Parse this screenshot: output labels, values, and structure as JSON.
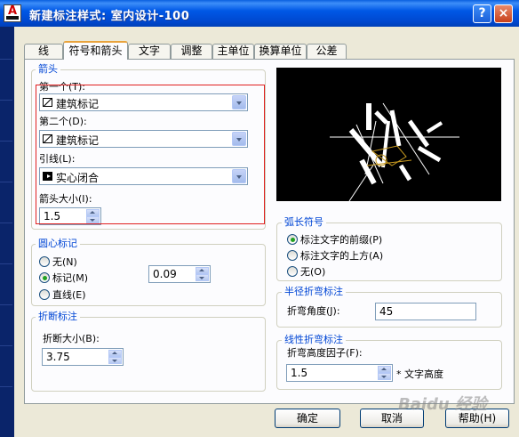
{
  "window": {
    "title": "新建标注样式: 室内设计-100",
    "help_symbol": "?",
    "close_symbol": "×",
    "app_icon_letter": "A"
  },
  "tabs": [
    "线",
    "符号和箭头",
    "文字",
    "调整",
    "主单位",
    "换算单位",
    "公差"
  ],
  "active_tab": "符号和箭头",
  "arrows": {
    "group_title": "箭头",
    "first_label": "第一个(T):",
    "first_value": "建筑标记",
    "second_label": "第二个(D):",
    "second_value": "建筑标记",
    "leader_label": "引线(L):",
    "leader_value": "实心闭合",
    "size_label": "箭头大小(I):",
    "size_value": "1.5"
  },
  "center_marks": {
    "group_title": "圆心标记",
    "options": [
      "无(N)",
      "标记(M)",
      "直线(E)"
    ],
    "selected": "标记(M)",
    "size_value": "0.09"
  },
  "break": {
    "group_title": "折断标注",
    "size_label": "折断大小(B):",
    "size_value": "3.75"
  },
  "arc_symbol": {
    "group_title": "弧长符号",
    "options": [
      "标注文字的前缀(P)",
      "标注文字的上方(A)",
      "无(O)"
    ],
    "selected": "标注文字的前缀(P)"
  },
  "radius_jog": {
    "group_title": "半径折弯标注",
    "angle_label": "折弯角度(J):",
    "angle_value": "45"
  },
  "linear_jog": {
    "group_title": "线性折弯标注",
    "height_label": "折弯高度因子(F):",
    "height_value": "1.5",
    "suffix": "* 文字高度"
  },
  "buttons": {
    "ok": "确定",
    "cancel": "取消",
    "help": "帮助(H)"
  },
  "watermark": "Baidu 经验",
  "colors": {
    "title_bar": "#0054e3",
    "group_title": "#0046d5",
    "highlight_box": "#e02020",
    "preview_bg": "#000000"
  }
}
